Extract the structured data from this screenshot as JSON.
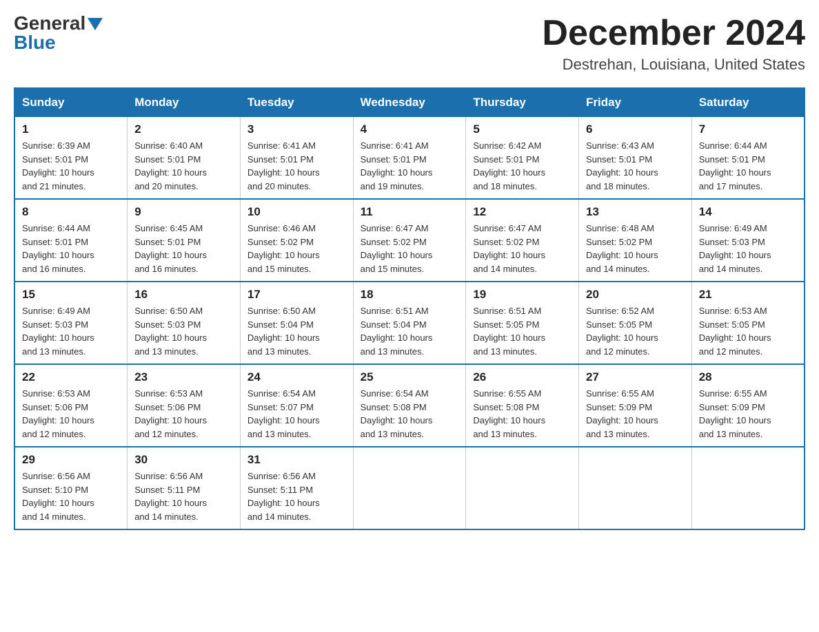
{
  "logo": {
    "general": "General",
    "blue": "Blue"
  },
  "title": "December 2024",
  "location": "Destrehan, Louisiana, United States",
  "days_of_week": [
    "Sunday",
    "Monday",
    "Tuesday",
    "Wednesday",
    "Thursday",
    "Friday",
    "Saturday"
  ],
  "weeks": [
    [
      {
        "day": "1",
        "sunrise": "6:39 AM",
        "sunset": "5:01 PM",
        "daylight": "10 hours and 21 minutes."
      },
      {
        "day": "2",
        "sunrise": "6:40 AM",
        "sunset": "5:01 PM",
        "daylight": "10 hours and 20 minutes."
      },
      {
        "day": "3",
        "sunrise": "6:41 AM",
        "sunset": "5:01 PM",
        "daylight": "10 hours and 20 minutes."
      },
      {
        "day": "4",
        "sunrise": "6:41 AM",
        "sunset": "5:01 PM",
        "daylight": "10 hours and 19 minutes."
      },
      {
        "day": "5",
        "sunrise": "6:42 AM",
        "sunset": "5:01 PM",
        "daylight": "10 hours and 18 minutes."
      },
      {
        "day": "6",
        "sunrise": "6:43 AM",
        "sunset": "5:01 PM",
        "daylight": "10 hours and 18 minutes."
      },
      {
        "day": "7",
        "sunrise": "6:44 AM",
        "sunset": "5:01 PM",
        "daylight": "10 hours and 17 minutes."
      }
    ],
    [
      {
        "day": "8",
        "sunrise": "6:44 AM",
        "sunset": "5:01 PM",
        "daylight": "10 hours and 16 minutes."
      },
      {
        "day": "9",
        "sunrise": "6:45 AM",
        "sunset": "5:01 PM",
        "daylight": "10 hours and 16 minutes."
      },
      {
        "day": "10",
        "sunrise": "6:46 AM",
        "sunset": "5:02 PM",
        "daylight": "10 hours and 15 minutes."
      },
      {
        "day": "11",
        "sunrise": "6:47 AM",
        "sunset": "5:02 PM",
        "daylight": "10 hours and 15 minutes."
      },
      {
        "day": "12",
        "sunrise": "6:47 AM",
        "sunset": "5:02 PM",
        "daylight": "10 hours and 14 minutes."
      },
      {
        "day": "13",
        "sunrise": "6:48 AM",
        "sunset": "5:02 PM",
        "daylight": "10 hours and 14 minutes."
      },
      {
        "day": "14",
        "sunrise": "6:49 AM",
        "sunset": "5:03 PM",
        "daylight": "10 hours and 14 minutes."
      }
    ],
    [
      {
        "day": "15",
        "sunrise": "6:49 AM",
        "sunset": "5:03 PM",
        "daylight": "10 hours and 13 minutes."
      },
      {
        "day": "16",
        "sunrise": "6:50 AM",
        "sunset": "5:03 PM",
        "daylight": "10 hours and 13 minutes."
      },
      {
        "day": "17",
        "sunrise": "6:50 AM",
        "sunset": "5:04 PM",
        "daylight": "10 hours and 13 minutes."
      },
      {
        "day": "18",
        "sunrise": "6:51 AM",
        "sunset": "5:04 PM",
        "daylight": "10 hours and 13 minutes."
      },
      {
        "day": "19",
        "sunrise": "6:51 AM",
        "sunset": "5:05 PM",
        "daylight": "10 hours and 13 minutes."
      },
      {
        "day": "20",
        "sunrise": "6:52 AM",
        "sunset": "5:05 PM",
        "daylight": "10 hours and 12 minutes."
      },
      {
        "day": "21",
        "sunrise": "6:53 AM",
        "sunset": "5:05 PM",
        "daylight": "10 hours and 12 minutes."
      }
    ],
    [
      {
        "day": "22",
        "sunrise": "6:53 AM",
        "sunset": "5:06 PM",
        "daylight": "10 hours and 12 minutes."
      },
      {
        "day": "23",
        "sunrise": "6:53 AM",
        "sunset": "5:06 PM",
        "daylight": "10 hours and 12 minutes."
      },
      {
        "day": "24",
        "sunrise": "6:54 AM",
        "sunset": "5:07 PM",
        "daylight": "10 hours and 13 minutes."
      },
      {
        "day": "25",
        "sunrise": "6:54 AM",
        "sunset": "5:08 PM",
        "daylight": "10 hours and 13 minutes."
      },
      {
        "day": "26",
        "sunrise": "6:55 AM",
        "sunset": "5:08 PM",
        "daylight": "10 hours and 13 minutes."
      },
      {
        "day": "27",
        "sunrise": "6:55 AM",
        "sunset": "5:09 PM",
        "daylight": "10 hours and 13 minutes."
      },
      {
        "day": "28",
        "sunrise": "6:55 AM",
        "sunset": "5:09 PM",
        "daylight": "10 hours and 13 minutes."
      }
    ],
    [
      {
        "day": "29",
        "sunrise": "6:56 AM",
        "sunset": "5:10 PM",
        "daylight": "10 hours and 14 minutes."
      },
      {
        "day": "30",
        "sunrise": "6:56 AM",
        "sunset": "5:11 PM",
        "daylight": "10 hours and 14 minutes."
      },
      {
        "day": "31",
        "sunrise": "6:56 AM",
        "sunset": "5:11 PM",
        "daylight": "10 hours and 14 minutes."
      },
      null,
      null,
      null,
      null
    ]
  ],
  "labels": {
    "sunrise": "Sunrise:",
    "sunset": "Sunset:",
    "daylight": "Daylight:"
  }
}
